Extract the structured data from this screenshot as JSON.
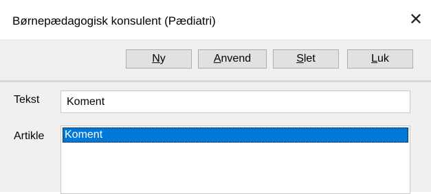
{
  "window": {
    "title": "Børnepædagogisk konsulent (Pædiatri)",
    "close_glyph": "✕"
  },
  "toolbar": {
    "ny": {
      "mnemonic": "N",
      "rest": "y"
    },
    "anvend": {
      "mnemonic": "A",
      "rest": "nvend"
    },
    "slet": {
      "mnemonic": "S",
      "rest": "let"
    },
    "luk": {
      "mnemonic": "L",
      "rest": "uk"
    }
  },
  "form": {
    "tekst_label": "Tekst",
    "tekst_value": "Koment",
    "artikle_label": "Artikle",
    "artikle_items": [
      {
        "text": "Koment",
        "selected": true
      }
    ]
  },
  "colors": {
    "selection": "#0078d7",
    "toolbar_bg": "#f0f0f0",
    "button_bg": "#e1e1e1"
  }
}
